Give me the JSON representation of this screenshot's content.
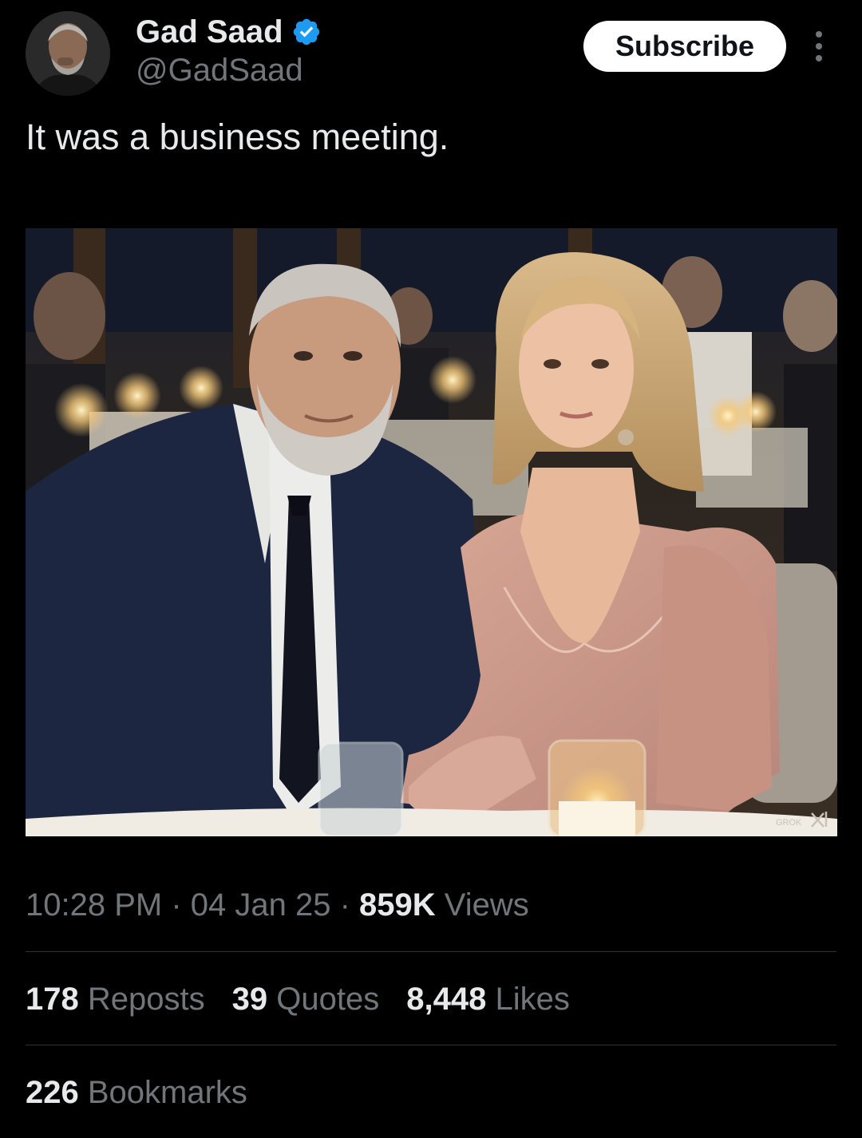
{
  "author": {
    "display_name": "Gad Saad",
    "handle": "@GadSaad",
    "verified_icon": "verified-badge-icon",
    "avatar_icon": "avatar-portrait"
  },
  "actions": {
    "subscribe_label": "Subscribe",
    "more_icon": "more-vertical-icon"
  },
  "tweet": {
    "text": "It was a business meeting.",
    "media": {
      "watermark": "GROK",
      "watermark_logo": "xai-logo"
    }
  },
  "meta": {
    "time": "10:28 PM",
    "separator": " · ",
    "date": "04 Jan 25",
    "views_count": "859K",
    "views_label": "Views"
  },
  "stats": {
    "reposts_count": "178",
    "reposts_label": "Reposts",
    "quotes_count": "39",
    "quotes_label": "Quotes",
    "likes_count": "8,448",
    "likes_label": "Likes",
    "bookmarks_count": "226",
    "bookmarks_label": "Bookmarks"
  },
  "colors": {
    "background": "#000000",
    "primary_text": "#e7e9ea",
    "secondary_text": "#71767b",
    "divider": "#2f3336",
    "verified_blue": "#1d9bf0",
    "subscribe_bg": "#ffffff"
  }
}
